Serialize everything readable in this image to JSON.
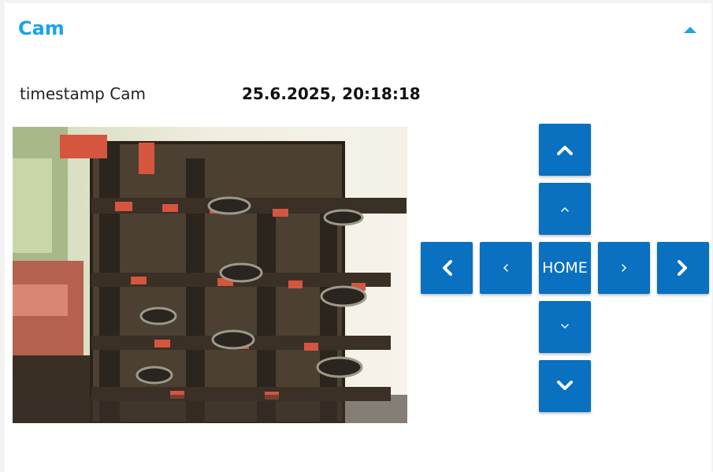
{
  "section": {
    "title": "Cam",
    "accent_color": "#1aa3e8",
    "collapse_icon": "caret-up-icon"
  },
  "timestamp": {
    "label": "timestamp Cam",
    "value": "25.6.2025, 20:18:18"
  },
  "camera": {
    "image_description_icon": "camera-feed"
  },
  "ptz": {
    "button_color": "#0a70c0",
    "home_label": "HOME",
    "buttons": [
      {
        "name": "tilt-up-large",
        "icon": "chevron-up-bold-icon"
      },
      {
        "name": "tilt-up-small",
        "icon": "chevron-up-thin-icon"
      },
      {
        "name": "pan-left-large",
        "icon": "chevron-left-bold-icon"
      },
      {
        "name": "pan-left-small",
        "icon": "chevron-left-thin-icon"
      },
      {
        "name": "pan-right-small",
        "icon": "chevron-right-thin-icon"
      },
      {
        "name": "pan-right-large",
        "icon": "chevron-right-bold-icon"
      },
      {
        "name": "tilt-down-small",
        "icon": "chevron-down-thin-icon"
      },
      {
        "name": "tilt-down-large",
        "icon": "chevron-down-bold-icon"
      }
    ]
  }
}
